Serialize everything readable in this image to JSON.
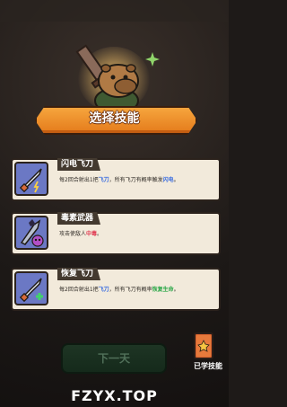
{
  "title": "选择技能",
  "skills": [
    {
      "name": "闪电飞刀",
      "desc_parts": [
        "每2回合射出1把",
        "飞刀",
        "，所有飞刀有概率触发",
        "闪电",
        "。"
      ],
      "icon": "lightning-knife-icon"
    },
    {
      "name": "毒素武器",
      "desc_parts": [
        "攻击使敌人",
        "中毒",
        "。"
      ],
      "icon": "poison-weapon-icon"
    },
    {
      "name": "恢复飞刀",
      "desc_parts": [
        "每2回合射出1把",
        "飞刀",
        "，所有飞刀有概率",
        "恢复生命",
        "。"
      ],
      "icon": "healing-knife-icon"
    }
  ],
  "buttons": {
    "next": "下一天",
    "learned": "已学技能"
  },
  "watermark": "FZYX.TOP",
  "colors": {
    "banner": "#f08c2a",
    "card": "#f2eadb",
    "icon_bg": "#6b78c4",
    "highlight_blue": "#3a6de0",
    "highlight_red": "#e03a52",
    "highlight_green": "#2ea84a"
  }
}
